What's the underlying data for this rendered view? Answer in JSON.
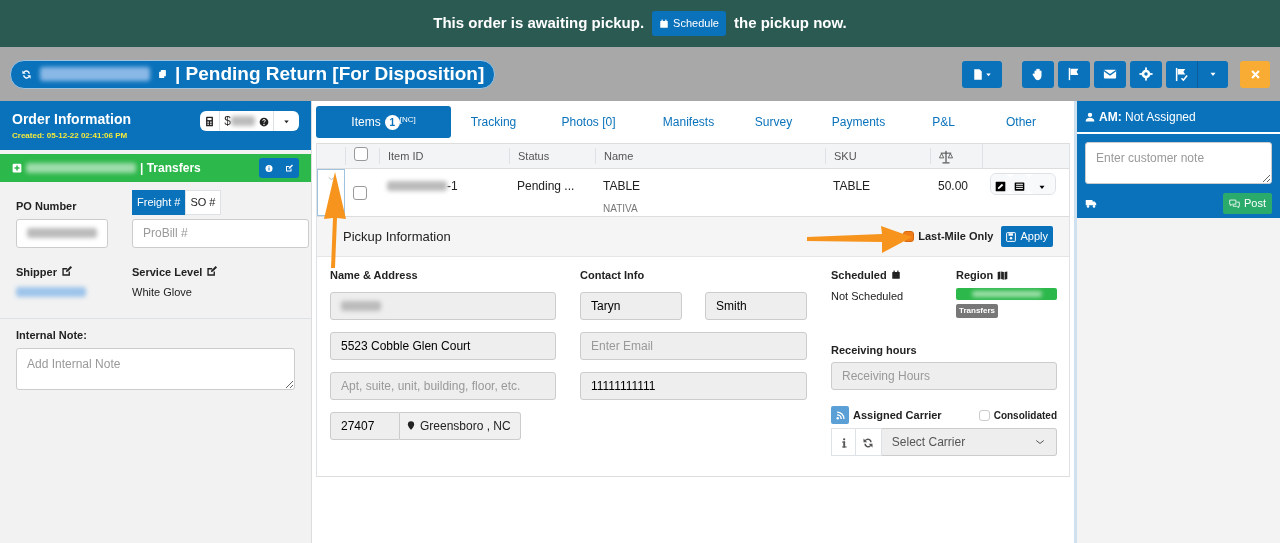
{
  "banner": {
    "text_before": "This order is awaiting pickup.",
    "button": "Schedule",
    "text_after": "the pickup now."
  },
  "header": {
    "title": "| Pending Return [For Disposition]"
  },
  "order_info": {
    "title": "Order Information",
    "created": "Created: 05-12-22 02:41:06 PM",
    "amount_prefix": "$"
  },
  "account": {
    "label": "| Transfers"
  },
  "left_fields": {
    "po_label": "PO Number",
    "ref_tabs": [
      {
        "label": "Freight #",
        "selected": true
      },
      {
        "label": "SO #",
        "selected": false
      }
    ],
    "probill_placeholder": "ProBill #",
    "shipper_label": "Shipper",
    "service_label": "Service Level",
    "service_value": "White Glove",
    "note_label": "Internal Note:",
    "note_placeholder": "Add Internal Note"
  },
  "tabs": [
    {
      "label": "Items",
      "badge": "1",
      "sup": "[NC]",
      "selected": true
    },
    {
      "label": "Tracking",
      "selected": false
    },
    {
      "label": "Photos [0]",
      "selected": false
    },
    {
      "label": "Manifests",
      "selected": false
    },
    {
      "label": "Survey",
      "selected": false
    },
    {
      "label": "Payments",
      "selected": false
    },
    {
      "label": "P&L",
      "selected": false
    },
    {
      "label": "Other",
      "selected": false
    }
  ],
  "table": {
    "all_checked": false,
    "columns": [
      "Item ID",
      "Status",
      "Name",
      "SKU"
    ],
    "rows": [
      {
        "item_id_suffix": "-1",
        "status": "Pending ...",
        "name": "TABLE",
        "subname": "NATIVA",
        "sku": "TABLE",
        "weight": "50.00",
        "expanded": true,
        "checked": false
      }
    ]
  },
  "pickup": {
    "title": "Pickup Information",
    "last_mile": {
      "label": "Last-Mile Only",
      "checked": true
    },
    "apply": "Apply",
    "name_label": "Name & Address",
    "address": "5523 Cobble Glen Court",
    "address2_placeholder": "Apt, suite, unit, building, floor, etc.",
    "zip": "27407",
    "city": "Greensboro , NC",
    "contact_label": "Contact Info",
    "first_name": "Taryn",
    "last_name": "Smith",
    "email_placeholder": "Enter Email",
    "phone": "11111111111",
    "scheduled_label": "Scheduled",
    "scheduled_value": "Not Scheduled",
    "region_label": "Region",
    "region_tag": "Transfers",
    "hours_label": "Receiving hours",
    "hours_placeholder": "Receiving Hours",
    "carrier_label": "Assigned Carrier",
    "consolidated": {
      "label": "Consolidated",
      "checked": false
    },
    "carrier_placeholder": "Select Carrier"
  },
  "right_panel": {
    "am_label": "AM:",
    "am_value": "Not Assigned",
    "note_placeholder": "Enter customer note",
    "post": "Post"
  }
}
